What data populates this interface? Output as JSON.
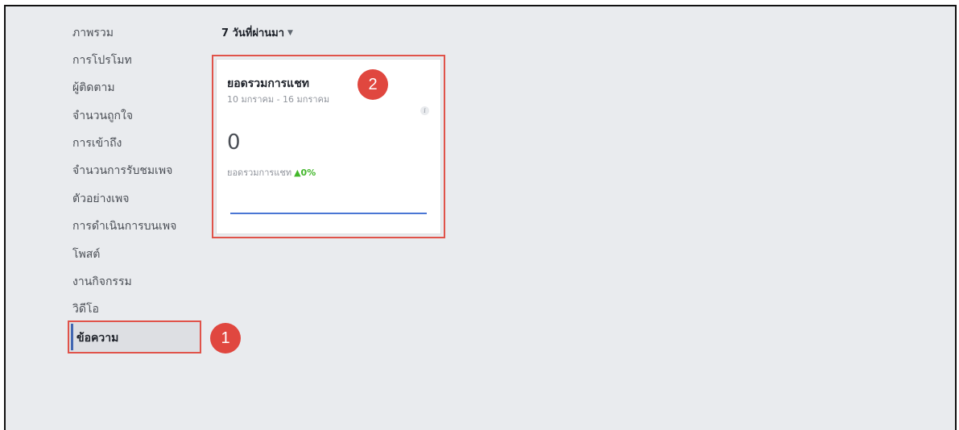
{
  "sidebar": {
    "items": [
      {
        "label": "ภาพรวม"
      },
      {
        "label": "การโปรโมท"
      },
      {
        "label": "ผู้ติดตาม"
      },
      {
        "label": "จำนวนถูกใจ"
      },
      {
        "label": "การเข้าถึง"
      },
      {
        "label": "จำนวนการรับชมเพจ"
      },
      {
        "label": "ตัวอย่างเพจ"
      },
      {
        "label": "การดำเนินการบนเพจ"
      },
      {
        "label": "โพสต์"
      },
      {
        "label": "งานกิจกรรม"
      },
      {
        "label": "วิดีโอ"
      },
      {
        "label": "ข้อความ",
        "active": true
      }
    ]
  },
  "header": {
    "date_range": "7 วันที่ผ่านมา",
    "caret_icon": "caret-down-icon"
  },
  "card": {
    "title": "ยอดรวมการแชท",
    "date_range": "10 มกราคม - 16 มกราคม",
    "info_icon": "info-icon",
    "value": "0",
    "metric_label": "ยอดรวมการแชท",
    "change": "▲0%",
    "change_color": "#42b72a",
    "sparkline_color": "#4a76d4"
  },
  "callouts": {
    "one": "1",
    "two": "2",
    "color": "#e0473f"
  }
}
